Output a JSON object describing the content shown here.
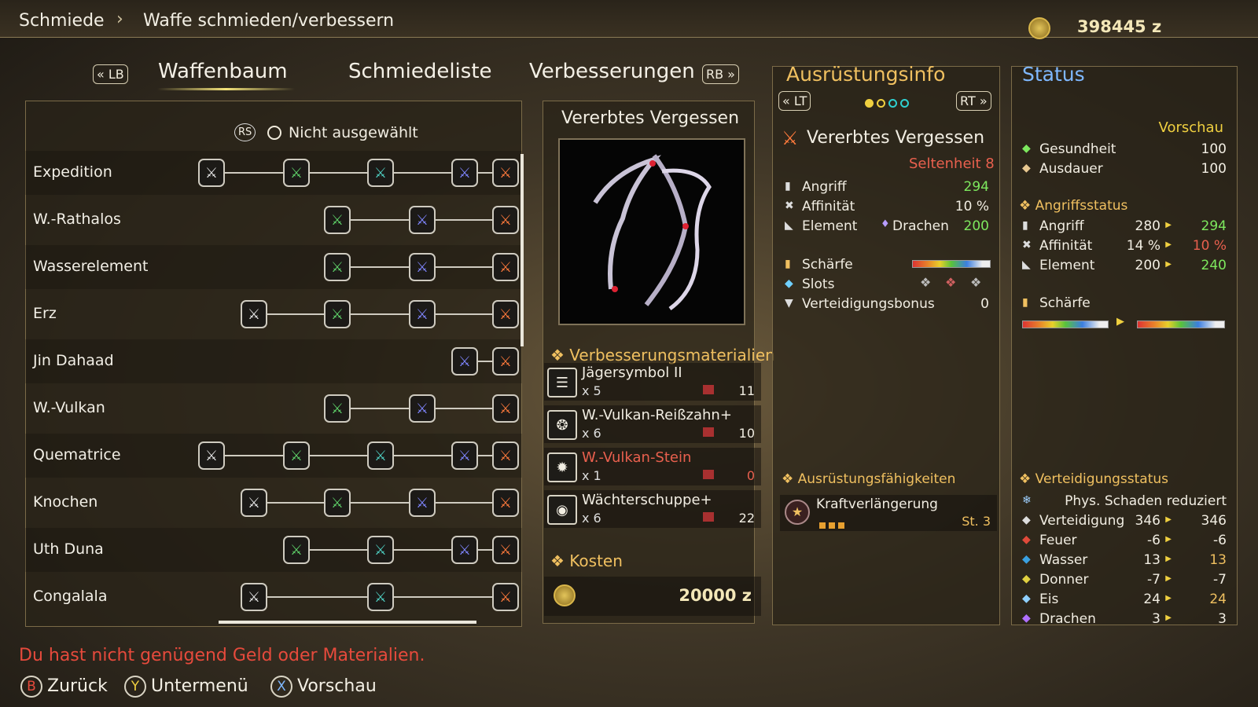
{
  "breadcrumb": {
    "section": "Schmiede",
    "page": "Waffe schmieden/verbessern"
  },
  "currency": {
    "amount": "398445 z"
  },
  "tabs": {
    "lb": "LB",
    "rb": "RB",
    "items": [
      "Waffenbaum",
      "Schmiedeliste",
      "Verbesserungen"
    ],
    "active": "Waffenbaum"
  },
  "filter": {
    "rs": "RS",
    "text": "Nicht ausgewählt"
  },
  "tree_rows": [
    "Expedition",
    "W.-Rathalos",
    "Wasserelement",
    "Erz",
    "Jin Dahaad",
    "W.-Vulkan",
    "Quematrice",
    "Knochen",
    "Uth Duna",
    "Congalala"
  ],
  "weapon": {
    "name": "Vererbtes Vergessen",
    "materials_title": "Verbesserungsmaterialien",
    "materials": [
      {
        "name": "Jägersymbol II",
        "qty": "x 5",
        "own": "11",
        "short": false
      },
      {
        "name": "W.-Vulkan-Reißzahn+",
        "qty": "x 6",
        "own": "10",
        "short": false
      },
      {
        "name": "W.-Vulkan-Stein",
        "qty": "x 1",
        "own": "0",
        "short": true
      },
      {
        "name": "Wächterschuppe+",
        "qty": "x 6",
        "own": "22",
        "short": false
      }
    ],
    "cost_title": "Kosten",
    "cost": "20000 z"
  },
  "equipment_info": {
    "title": "Ausrüstungsinfo",
    "lt": "LT",
    "rt": "RT",
    "name": "Vererbtes Vergessen",
    "rarity": "Seltenheit 8",
    "stats": [
      {
        "label": "Angriff",
        "value": "294"
      },
      {
        "label": "Affinität",
        "value": "10 %"
      },
      {
        "label": "Element",
        "element": "Drachen",
        "value": "200"
      }
    ],
    "sharpness": "Schärfe",
    "slots": "Slots",
    "defense_bonus": {
      "label": "Verteidigungsbonus",
      "value": "0"
    },
    "skills_title": "Ausrüstungsfähigkeiten",
    "skill": {
      "name": "Kraftverlängerung",
      "level": "St. 3"
    }
  },
  "status": {
    "title": "Status",
    "preview": "Vorschau",
    "health": {
      "label": "Gesundheit",
      "value": "100"
    },
    "stamina": {
      "label": "Ausdauer",
      "value": "100"
    },
    "attack_title": "Angriffsstatus",
    "attack": [
      {
        "label": "Angriff",
        "before": "280",
        "after": "294",
        "color": "green"
      },
      {
        "label": "Affinität",
        "before": "14 %",
        "after": "10 %",
        "color": "red"
      },
      {
        "label": "Element",
        "before": "200",
        "after": "240",
        "color": "green"
      }
    ],
    "sharpness": "Schärfe",
    "defense_title": "Verteidigungsstatus",
    "defense_note": "Phys. Schaden reduziert",
    "defense": [
      {
        "label": "Verteidigung",
        "before": "346",
        "after": "346",
        "color": "white"
      },
      {
        "label": "Feuer",
        "before": "-6",
        "after": "-6",
        "color": "white"
      },
      {
        "label": "Wasser",
        "before": "13",
        "after": "13",
        "color": "gold"
      },
      {
        "label": "Donner",
        "before": "-7",
        "after": "-7",
        "color": "white"
      },
      {
        "label": "Eis",
        "before": "24",
        "after": "24",
        "color": "gold"
      },
      {
        "label": "Drachen",
        "before": "3",
        "after": "3",
        "color": "white"
      }
    ]
  },
  "warning": "Du hast nicht genügend Geld oder Materialien.",
  "hints": [
    {
      "button": "B",
      "label": "Zurück"
    },
    {
      "button": "Y",
      "label": "Untermenü"
    },
    {
      "button": "X",
      "label": "Vorschau"
    }
  ],
  "colors": {
    "accent": "#f0c060",
    "warning": "#e64a3c",
    "increase": "#7de85e",
    "decrease": "#e9604e",
    "status_title": "#7fb8ff"
  }
}
